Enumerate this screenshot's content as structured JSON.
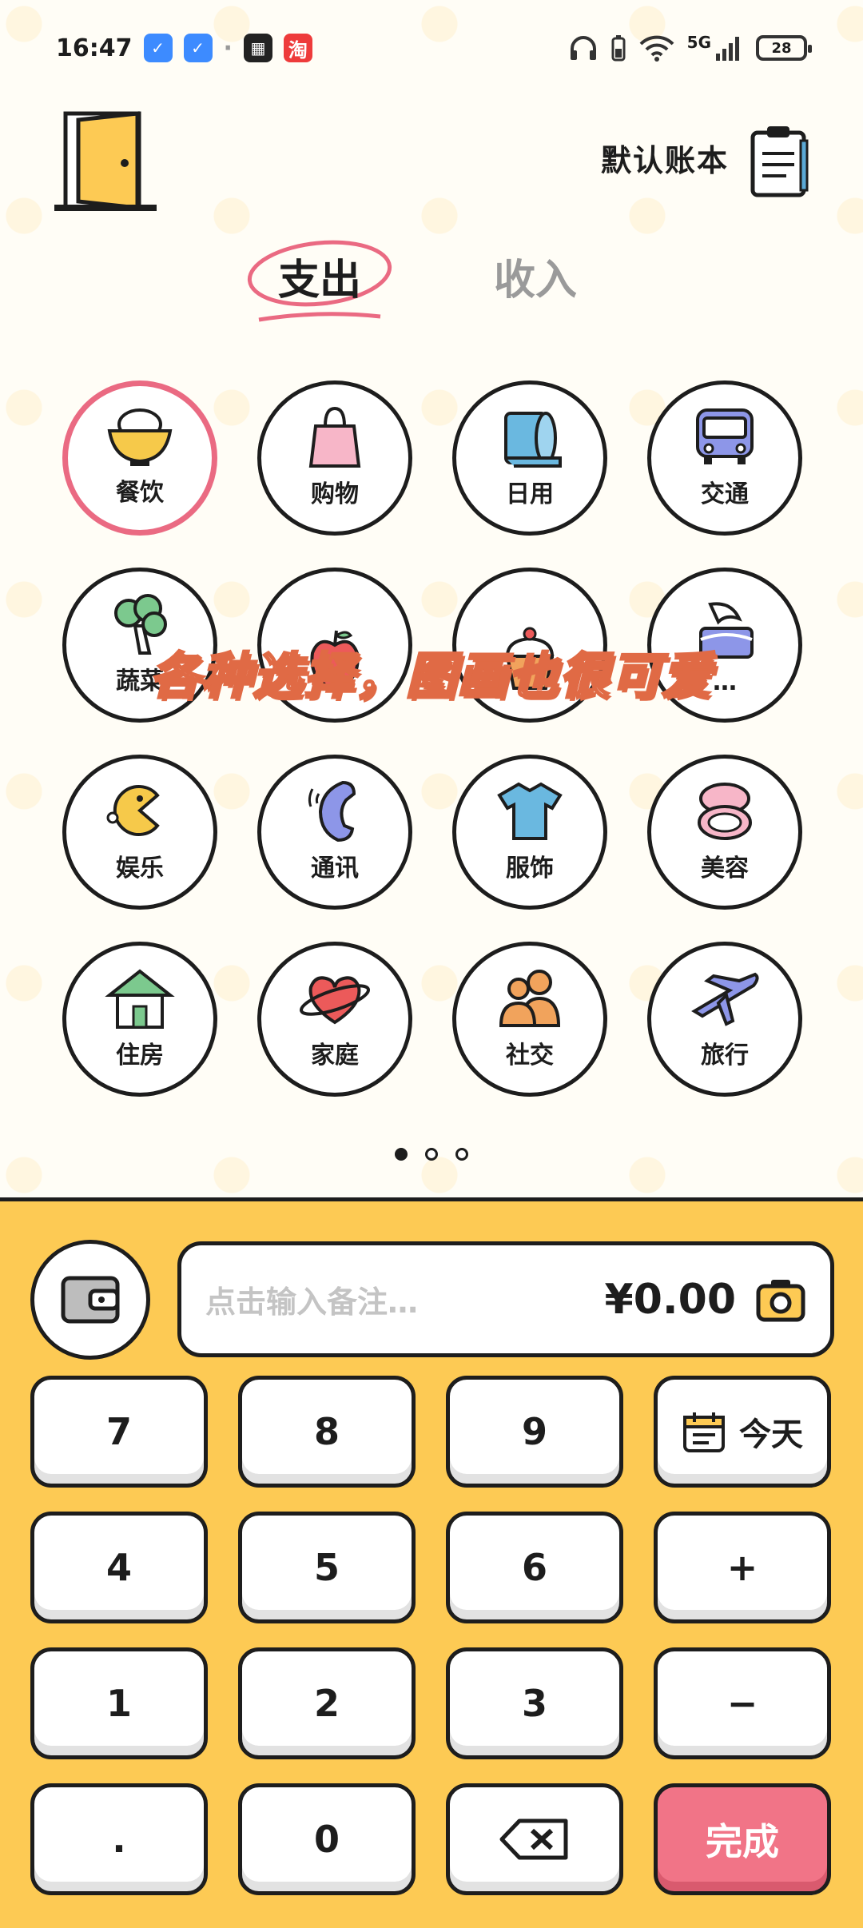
{
  "status_bar": {
    "time": "16:47",
    "apps": [
      "✓",
      "✓",
      "·",
      "▦",
      "淘"
    ],
    "network": "5G",
    "battery": "28"
  },
  "header": {
    "book_title": "默认账本"
  },
  "tabs": {
    "expense": "支出",
    "income": "收入"
  },
  "categories": [
    {
      "label": "餐饮",
      "icon": "rice-bowl-icon",
      "selected": true
    },
    {
      "label": "购物",
      "icon": "shopping-bag-icon"
    },
    {
      "label": "日用",
      "icon": "toilet-paper-icon"
    },
    {
      "label": "交通",
      "icon": "bus-icon"
    },
    {
      "label": "蔬菜",
      "icon": "broccoli-icon"
    },
    {
      "label": "",
      "icon": "apple-icon"
    },
    {
      "label": "",
      "icon": "cupcake-icon"
    },
    {
      "label": "…",
      "icon": "snack-icon"
    },
    {
      "label": "娱乐",
      "icon": "pacman-icon"
    },
    {
      "label": "通讯",
      "icon": "phone-icon"
    },
    {
      "label": "服饰",
      "icon": "tshirt-icon"
    },
    {
      "label": "美容",
      "icon": "compact-mirror-icon"
    },
    {
      "label": "住房",
      "icon": "house-icon"
    },
    {
      "label": "家庭",
      "icon": "heart-planet-icon"
    },
    {
      "label": "社交",
      "icon": "people-icon"
    },
    {
      "label": "旅行",
      "icon": "airplane-icon"
    }
  ],
  "overlay_caption": "各种选择，图画也很可爱",
  "pager": {
    "pages": 3,
    "active": 0
  },
  "input": {
    "placeholder": "点击输入备注…",
    "amount": "¥0.00"
  },
  "keypad": {
    "rows": [
      [
        "7",
        "8",
        "9",
        "今天"
      ],
      [
        "4",
        "5",
        "6",
        "+"
      ],
      [
        "1",
        "2",
        "3",
        "−"
      ],
      [
        ".",
        "0",
        "",
        "完成"
      ]
    ]
  },
  "colors": {
    "panel": "#fdca54",
    "selected_ring": "#ea6a82",
    "done_button": "#f17487"
  }
}
